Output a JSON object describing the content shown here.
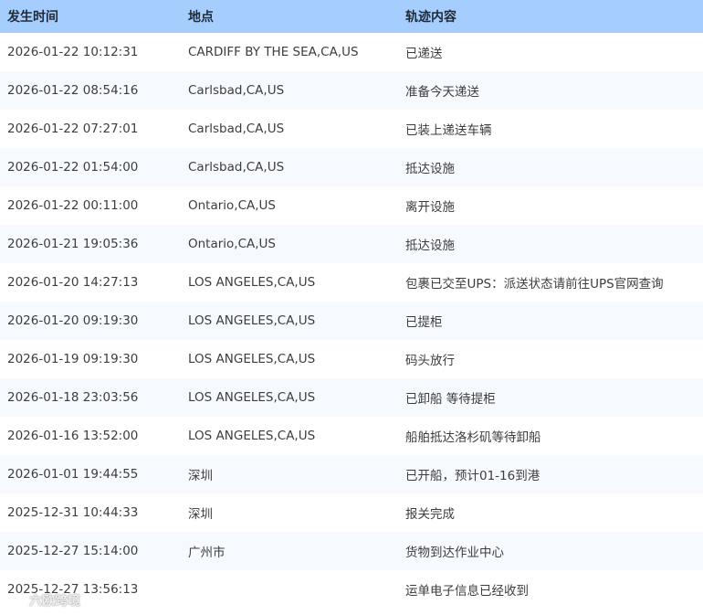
{
  "headers": {
    "time": "发生时间",
    "location": "地点",
    "description": "轨迹内容"
  },
  "rows": [
    {
      "time": "2026-01-22 10:12:31",
      "location": "CARDIFF BY THE SEA,CA,US",
      "description": "已递送"
    },
    {
      "time": "2026-01-22 08:54:16",
      "location": "Carlsbad,CA,US",
      "description": "准备今天递送"
    },
    {
      "time": "2026-01-22 07:27:01",
      "location": "Carlsbad,CA,US",
      "description": "已装上递送车辆"
    },
    {
      "time": "2026-01-22 01:54:00",
      "location": "Carlsbad,CA,US",
      "description": "抵达设施"
    },
    {
      "time": "2026-01-22 00:11:00",
      "location": "Ontario,CA,US",
      "description": "离开设施"
    },
    {
      "time": "2026-01-21 19:05:36",
      "location": "Ontario,CA,US",
      "description": "抵达设施"
    },
    {
      "time": "2026-01-20 14:27:13",
      "location": "LOS ANGELES,CA,US",
      "description": "包裹已交至UPS：派送状态请前往UPS官网查询"
    },
    {
      "time": "2026-01-20 09:19:30",
      "location": "LOS ANGELES,CA,US",
      "description": "已提柜"
    },
    {
      "time": "2026-01-19 09:19:30",
      "location": "LOS ANGELES,CA,US",
      "description": "码头放行"
    },
    {
      "time": "2026-01-18 23:03:56",
      "location": "LOS ANGELES,CA,US",
      "description": "已卸船 等待提柜"
    },
    {
      "time": "2026-01-16 13:52:00",
      "location": "LOS ANGELES,CA,US",
      "description": "船舶抵达洛杉矶等待卸船"
    },
    {
      "time": "2026-01-01 19:44:55",
      "location": "深圳",
      "description": "已开船，预计01-16到港"
    },
    {
      "time": "2025-12-31 10:44:33",
      "location": "深圳",
      "description": "报关完成"
    },
    {
      "time": "2025-12-27 15:14:00",
      "location": "广州市",
      "description": "货物到达作业中心"
    },
    {
      "time": "2025-12-27 13:56:13",
      "location": "",
      "description": "运单电子信息已经收到"
    }
  ],
  "watermark": {
    "text": "六欧跨境",
    "icon": "logo-icon"
  },
  "colors": {
    "header_bg": "#a5ceff",
    "row_alt_bg": "#f6f9fe",
    "text": "#3d3d3d"
  }
}
